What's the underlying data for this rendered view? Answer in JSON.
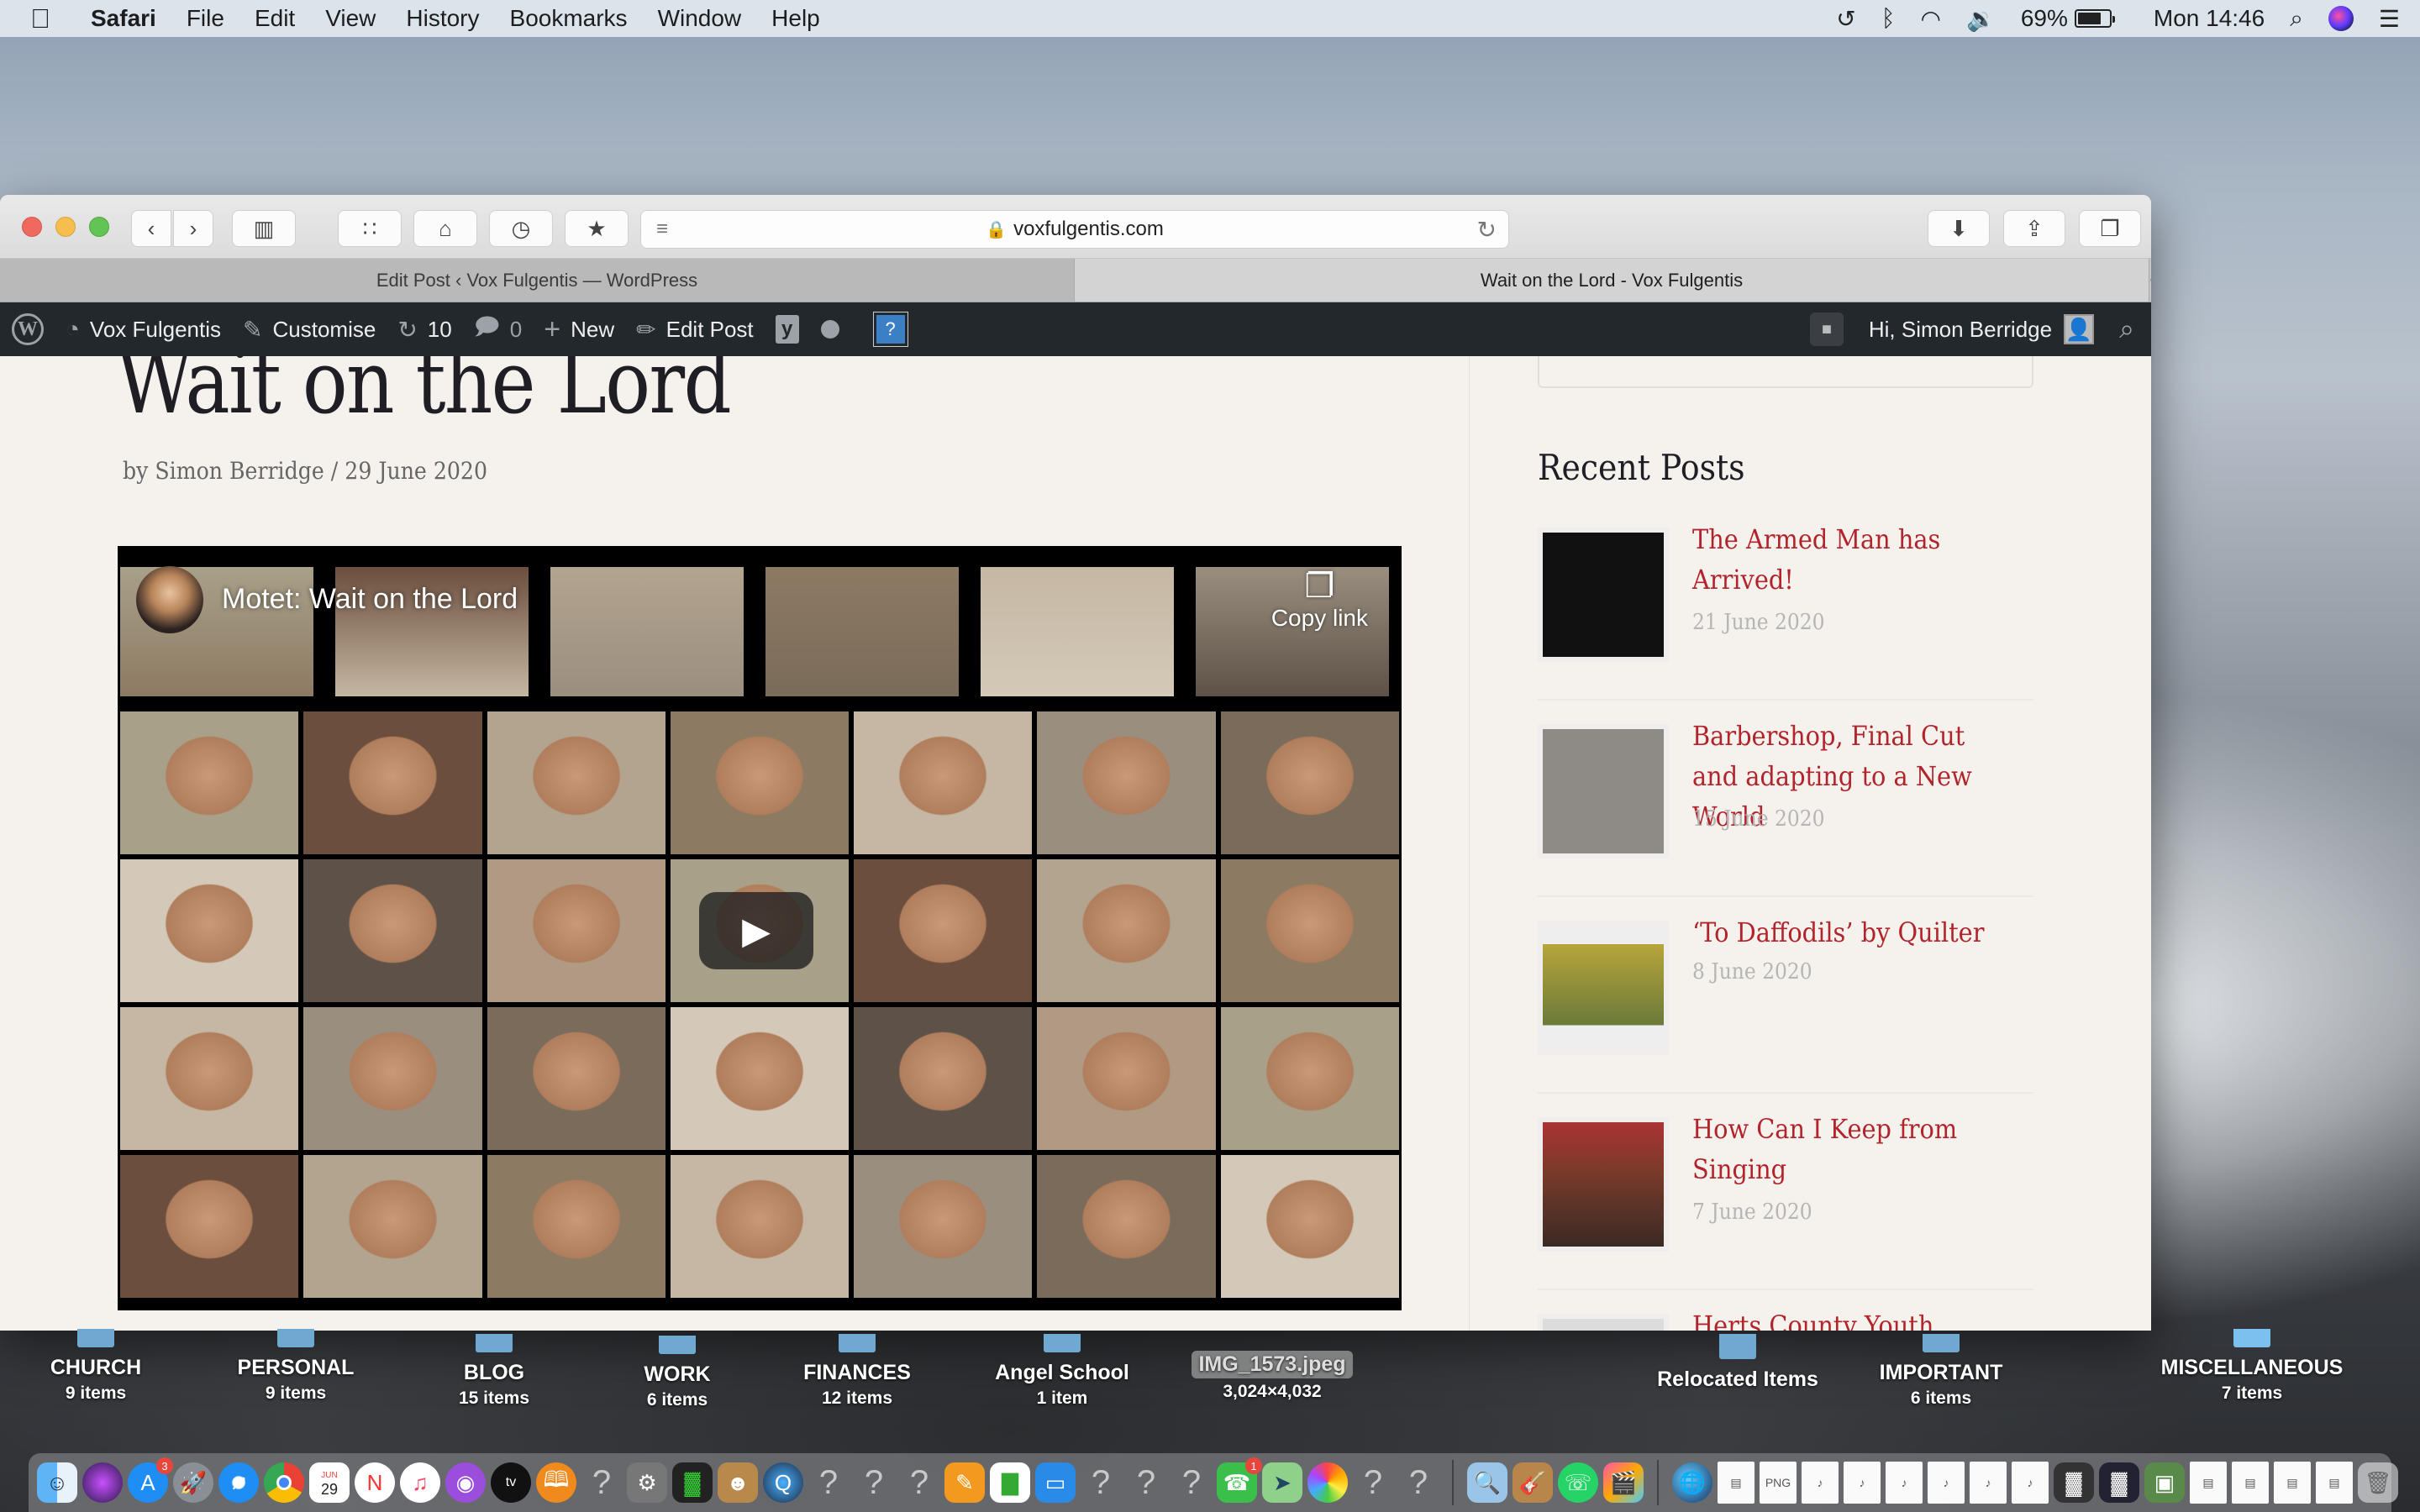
{
  "menubar": {
    "app_name": "Safari",
    "menus": [
      "File",
      "Edit",
      "View",
      "History",
      "Bookmarks",
      "Window",
      "Help"
    ],
    "status": {
      "battery_percent_label": "69%",
      "battery_level": 0.69,
      "clock": "Mon 14:46",
      "icons": [
        "time-machine-icon",
        "bluetooth-icon",
        "wifi-icon",
        "volume-icon",
        "battery-icon",
        "spotlight-icon",
        "siri-icon",
        "notification-center-icon"
      ]
    }
  },
  "browser": {
    "url": "voxfulgentis.com",
    "tabs": [
      {
        "label": "Edit Post ‹ Vox Fulgentis — WordPress",
        "active": false
      },
      {
        "label": "Wait on the Lord - Vox Fulgentis",
        "active": true
      }
    ],
    "new_tab_label": "+"
  },
  "adminbar": {
    "site_name": "Vox Fulgentis",
    "customise": "Customise",
    "updates_count": "10",
    "comments_count": "0",
    "new_label": "New",
    "edit_post_label": "Edit Post",
    "help_label": "?",
    "greeting": "Hi, Simon Berridge"
  },
  "post": {
    "title": "Wait on the Lord",
    "meta": "by Simon Berridge / 29 June 2020",
    "video": {
      "title": "Motet: Wait on the Lord",
      "copy_link_label": "Copy link",
      "play_label": "▶"
    }
  },
  "sidebar": {
    "heading": "Recent Posts",
    "posts": [
      {
        "title": "The Armed Man has Arrived!",
        "date": "21 June 2020",
        "thumb_color": "#1a1a1a"
      },
      {
        "title": "Barbershop, Final Cut and adapting to a New World",
        "date": "15 June 2020",
        "thumb_color": "#8e8b86"
      },
      {
        "title": "‘To Daffodils’ by Quilter",
        "date": "8 June 2020",
        "thumb_color": "#b7a53a"
      },
      {
        "title": "How Can I Keep from Singing",
        "date": "7 June 2020",
        "thumb_color": "#7a3a2a"
      },
      {
        "title": "Herts County Youth Choir Webinars",
        "date": "",
        "thumb_color": "#dcdcdc"
      }
    ]
  },
  "desktop": {
    "items": [
      {
        "name": "CHURCH",
        "count": "9 items"
      },
      {
        "name": "PERSONAL",
        "count": "9 items"
      },
      {
        "name": "BLOG",
        "count": "15 items"
      },
      {
        "name": "WORK",
        "count": "6 items"
      },
      {
        "name": "FINANCES",
        "count": "12 items"
      },
      {
        "name": "Angel School",
        "count": "1 item"
      },
      {
        "name": "IMG_1573.jpeg",
        "count": "3,024×4,032"
      },
      {
        "name": "Relocated Items",
        "count": ""
      },
      {
        "name": "IMPORTANT",
        "count": "6 items"
      },
      {
        "name": "MISCELLANEOUS",
        "count": "7 items"
      }
    ]
  },
  "dock": {
    "app_store_badge": "3",
    "facetime_badge": "1",
    "calendar_day": "29",
    "calendar_month": "JUN"
  }
}
